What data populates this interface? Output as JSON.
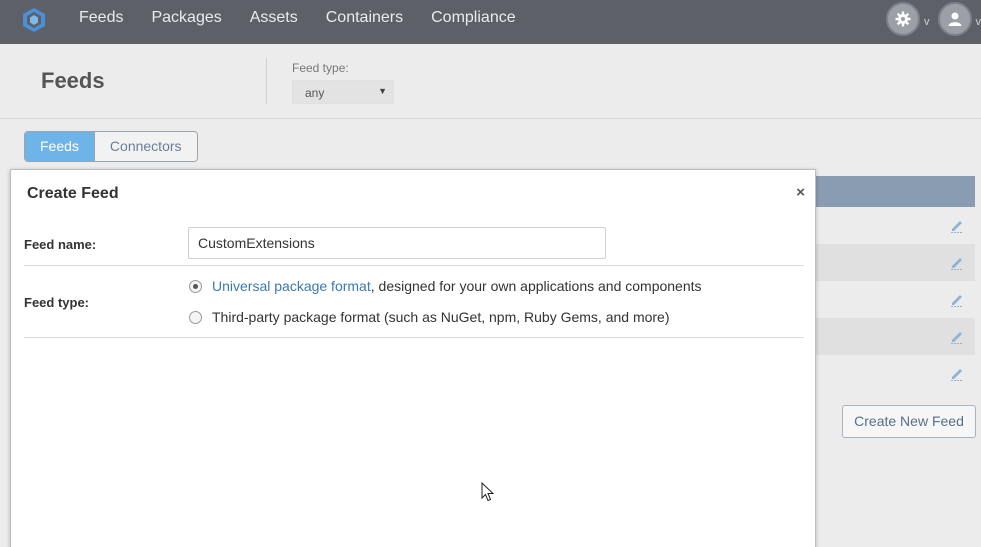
{
  "topnav": {
    "items": [
      {
        "label": "Feeds"
      },
      {
        "label": "Packages"
      },
      {
        "label": "Assets"
      },
      {
        "label": "Containers"
      },
      {
        "label": "Compliance"
      }
    ],
    "settings_icon": "gear-icon",
    "user_icon": "user-icon",
    "caret": "v"
  },
  "header": {
    "title": "Feeds",
    "feed_type_label": "Feed type:",
    "feed_type_value": "any"
  },
  "tabs": [
    {
      "label": "Feeds",
      "active": true
    },
    {
      "label": "Connectors",
      "active": false
    }
  ],
  "background": {
    "create_new_feed_label": "Create New Feed"
  },
  "modal": {
    "title": "Create Feed",
    "close_symbol": "×",
    "feed_name_label": "Feed name:",
    "feed_name_value": "CustomExtensions",
    "feed_type_label": "Feed type:",
    "options": [
      {
        "link_text": "Universal package format",
        "rest_text": ", designed for your own applications and components",
        "checked": true
      },
      {
        "link_text": "",
        "rest_text": "Third-party package format (such as NuGet, npm, Ruby Gems, and more)",
        "checked": false
      }
    ]
  },
  "colors": {
    "nav_bg": "#5d6167",
    "accent": "#6fb4e8",
    "table_header": "#8a9cb1",
    "link": "#3b78b5"
  }
}
